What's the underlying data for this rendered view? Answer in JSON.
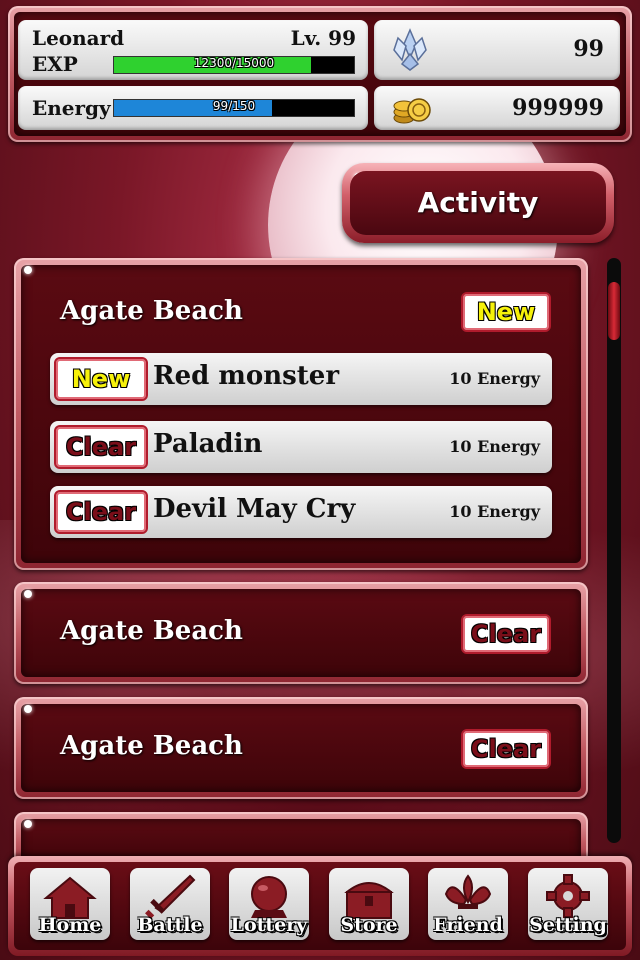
{
  "player": {
    "name": "Leonard",
    "level_label": "Lv. 99",
    "exp_label": "EXP",
    "exp_text": "12300/15000",
    "exp_fraction": 0.82,
    "energy_label": "Energy",
    "energy_text": "99/150",
    "energy_fraction": 0.66
  },
  "currency": {
    "crystals": "99",
    "coins": "999999"
  },
  "activity_button": "Activity",
  "sections": [
    {
      "title": "Agate Beach",
      "badge": "New",
      "quests": [
        {
          "badge": "New",
          "name": "Red monster",
          "cost": "10 Energy"
        },
        {
          "badge": "Clear",
          "name": "Paladin",
          "cost": "10 Energy"
        },
        {
          "badge": "Clear",
          "name": "Devil May Cry",
          "cost": "10 Energy"
        }
      ]
    },
    {
      "title": "Agate Beach",
      "badge": "Clear"
    },
    {
      "title": "Agate Beach",
      "badge": "Clear"
    }
  ],
  "nav": [
    {
      "label": "Home",
      "icon": "house-icon"
    },
    {
      "label": "Battle",
      "icon": "sword-icon"
    },
    {
      "label": "Lottery",
      "icon": "crystal-ball-icon"
    },
    {
      "label": "Store",
      "icon": "treasure-chest-icon"
    },
    {
      "label": "Friend",
      "icon": "fleur-de-lis-icon"
    },
    {
      "label": "Setting",
      "icon": "gear-icon"
    }
  ],
  "colors": {
    "exp_bar": "#2fd12f",
    "energy_bar": "#1e86d8",
    "accent": "#b01b2c"
  }
}
